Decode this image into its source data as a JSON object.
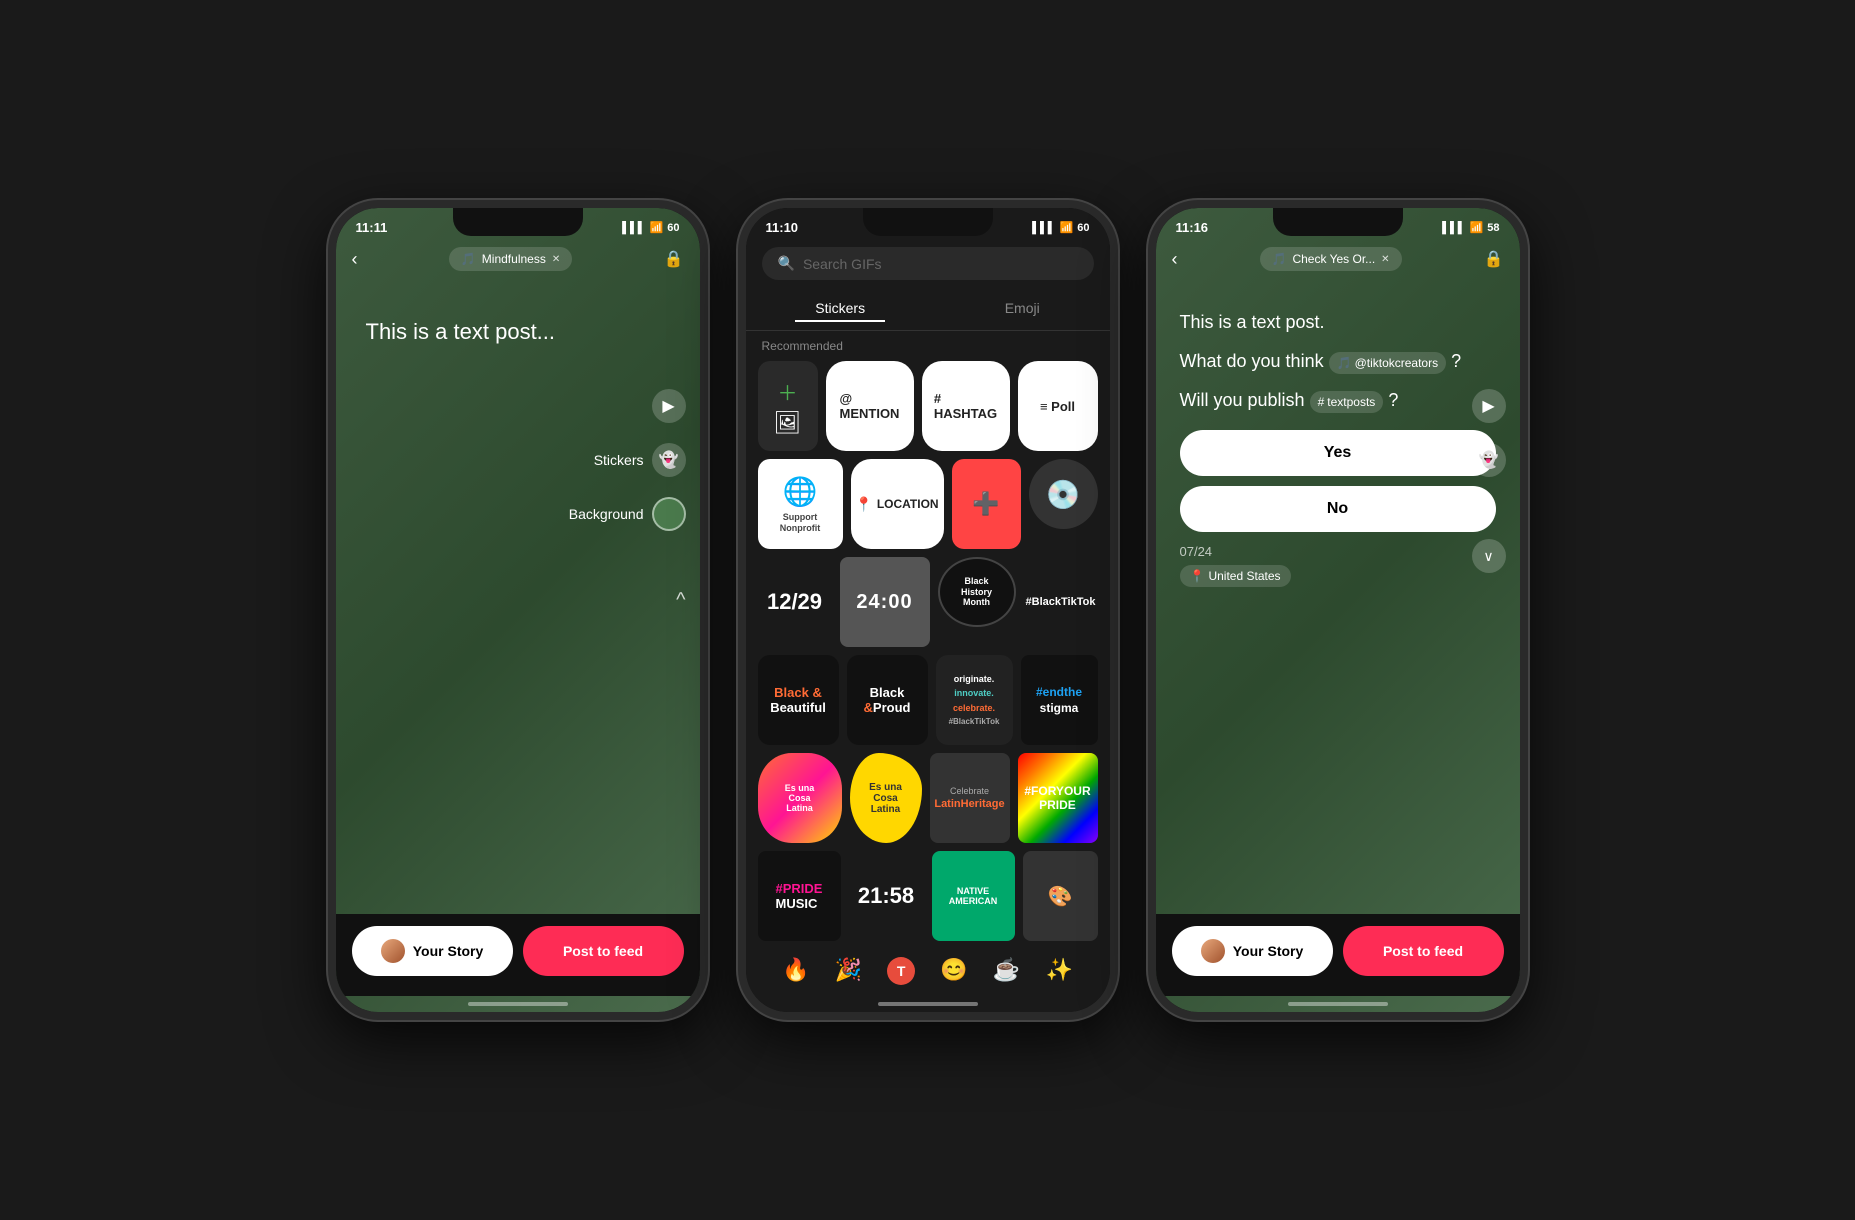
{
  "phone1": {
    "status": {
      "time": "11:11",
      "signal": "▌▌▌",
      "wifi": "WiFi",
      "battery": "60"
    },
    "music_pill": "Mindfulness",
    "stickers_label": "Stickers",
    "background_label": "Background",
    "post_text": "This is a text post...",
    "btn_story": "Your Story",
    "btn_feed": "Post to feed"
  },
  "phone2": {
    "status": {
      "time": "11:10",
      "signal": "▌▌▌",
      "wifi": "WiFi",
      "battery": "60"
    },
    "search_placeholder": "Search GIFs",
    "tab_stickers": "Stickers",
    "tab_emoji": "Emoji",
    "recommended": "Recommended",
    "stickers": {
      "row1": [
        "add",
        "mention",
        "hashtag",
        "poll"
      ],
      "row2": [
        "nonprofit",
        "location",
        "medical",
        "music_disc"
      ],
      "row3": [
        "date_1229",
        "time_2400",
        "black_history",
        "blacktiktok"
      ],
      "row4": [
        "black_beautiful",
        "black_proud",
        "originate",
        "end_stigma"
      ],
      "row5": [
        "cosa_latina1",
        "cosa_latina2",
        "latin_heritage",
        "for_pride"
      ],
      "row6": [
        "pride_music",
        "time_2158",
        "native_american",
        "pattern"
      ],
      "emoji_row": [
        "🔥",
        "🎉",
        "🅣",
        "😊",
        "☕",
        "✨"
      ]
    }
  },
  "phone3": {
    "status": {
      "time": "11:16",
      "signal": "▌▌▌",
      "wifi": "WiFi",
      "battery": "58"
    },
    "music_pill": "Check Yes Or...",
    "post_text": "This is a text post.",
    "question1": "What do you think",
    "tag1": "@tiktokcreators",
    "question1_end": "?",
    "question2": "Will you publish",
    "tag2": "#textposts",
    "question2_end": "?",
    "poll_yes": "Yes",
    "poll_no": "No",
    "date": "07/24",
    "location": "United States",
    "btn_story": "Your Story",
    "btn_feed": "Post to feed"
  },
  "colors": {
    "green_bg": "#3d5a3e",
    "accent_pink": "#fe2c55",
    "dark_bg": "#1a1a1a"
  }
}
